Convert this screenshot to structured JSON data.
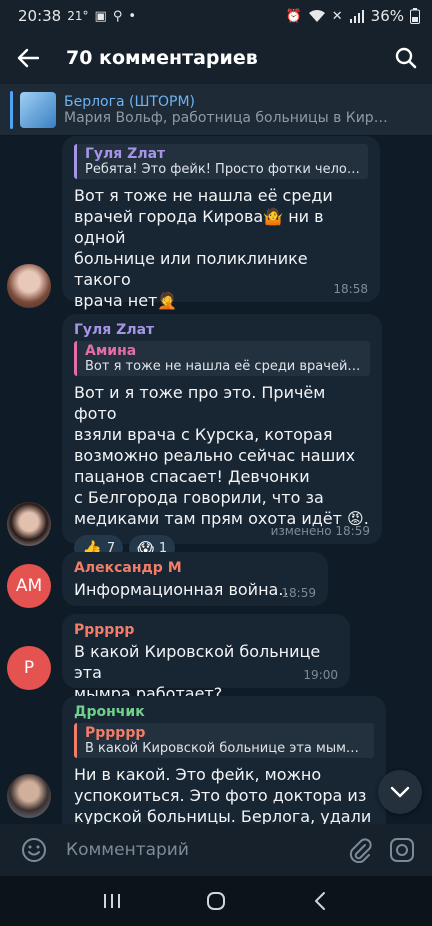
{
  "status_bar": {
    "time": "20:38",
    "temperature": "21°",
    "battery": "36%"
  },
  "top_bar": {
    "title": "70 комментариев"
  },
  "pinned": {
    "channel_name": "Берлога (ШТОРМ)",
    "preview": "Мария Вольф, работница больницы в Кирове..."
  },
  "messages": [
    {
      "author": "",
      "reply": {
        "name": "Гуля Zлат",
        "text": "Ребята! Это фейк! Просто фотки челове...",
        "color": "#a695e7"
      },
      "text": "Вот я тоже не нашла её среди\nврачей города Кирова🤷 ни в одной\nбольнице или поликлинике такого\nврача нет🤦",
      "reactions": [
        {
          "emoji": "👍",
          "count": ""
        },
        {
          "emoji": "👥",
          "count": ""
        }
      ],
      "time": "18:58"
    },
    {
      "author": "Гуля Zлат",
      "author_color": "#a695e7",
      "reply": {
        "name": "Амина",
        "text": "Вот я тоже не нашла её среди врачей го...",
        "color": "#e56ea6"
      },
      "text": "Вот и я тоже про это. Причём фото\nвзяли врача с Курска, которая\nвозможно реально сейчас наших\nпацанов спасает! Девчонки\nс Белгорода говорили, что за\nмедиками там прям охота идёт 😡.",
      "reactions": [
        {
          "emoji": "👍",
          "count": "7"
        },
        {
          "emoji": "😱",
          "count": "1"
        }
      ],
      "time": "изменено 18:59"
    },
    {
      "author": "Александр М",
      "author_color": "#f27d69",
      "avatar_text": "AM",
      "text": "Информационная война..",
      "time": "18:59"
    },
    {
      "author": "Рррррр",
      "author_color": "#f27d69",
      "avatar_text": "P",
      "text": "В какой Кировской больнице эта\nмымра работает?",
      "time": "19:00"
    },
    {
      "author": "Дрончик",
      "author_color": "#6fd18b",
      "reply": {
        "name": "Рррррр",
        "text": "В какой Кировской больнице эта мымра...",
        "color": "#f27d69"
      },
      "text": "Ни в какой. Это фейк, можно\nуспокоиться. Это фото доктора из\nкурской больницы. Берлога, удали",
      "time": ""
    }
  ],
  "composer": {
    "placeholder": "Комментарий"
  },
  "colors": {
    "background": "#0e1621",
    "bubble": "#182533",
    "accent": "#4ea4f6"
  }
}
